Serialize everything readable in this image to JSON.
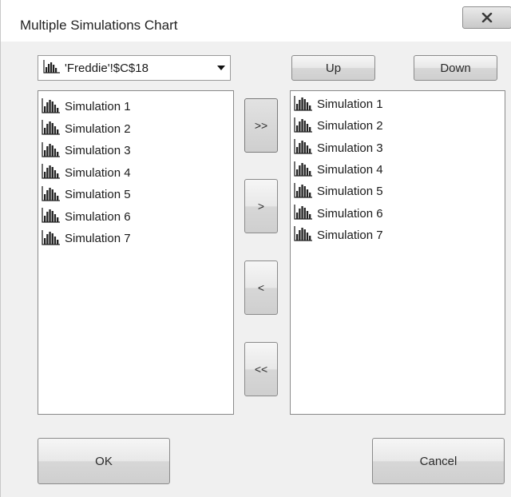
{
  "window": {
    "title": "Multiple Simulations Chart",
    "close_label": "X"
  },
  "source_selector": {
    "value": "'Freddie'!$C$18"
  },
  "buttons": {
    "up": "Up",
    "down": "Down",
    "add_all": ">>",
    "add": ">",
    "remove": "<",
    "remove_all": "<<",
    "ok": "OK",
    "cancel": "Cancel"
  },
  "available_list": {
    "items": [
      "Simulation 1",
      "Simulation 2",
      "Simulation 3",
      "Simulation 4",
      "Simulation 5",
      "Simulation 6",
      "Simulation 7"
    ]
  },
  "selected_list": {
    "items": [
      "Simulation 1",
      "Simulation 2",
      "Simulation 3",
      "Simulation 4",
      "Simulation 5",
      "Simulation 6",
      "Simulation 7"
    ]
  },
  "icons": {
    "simulation": "histogram-chart-icon",
    "dropdown": "chevron-down-icon",
    "close": "close-icon"
  },
  "colors": {
    "dialog_background": "#f0f0f0",
    "list_background": "#ffffff",
    "button_face": "#e4e4e4"
  }
}
